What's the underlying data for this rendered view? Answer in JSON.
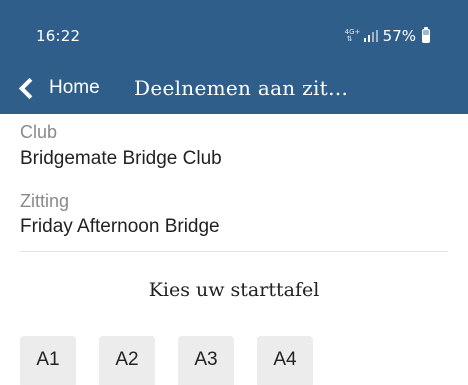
{
  "status_bar": {
    "time": "16:22",
    "network": "4G+",
    "network_icon": "network-4g-plus-icon",
    "signal_icon": "signal-strength-icon",
    "battery_percent": "57%",
    "battery_icon": "battery-icon"
  },
  "app_bar": {
    "back_label": "Home",
    "back_icon": "chevron-left-icon",
    "title": "Deelnemen aan zit…",
    "background_color": "#2f5e8b"
  },
  "club": {
    "label": "Club",
    "value": "Bridgemate Bridge Club"
  },
  "session": {
    "label": "Zitting",
    "value": "Friday Afternoon Bridge"
  },
  "table_prompt": "Kies uw starttafel",
  "tables": [
    {
      "label": "A1"
    },
    {
      "label": "A2"
    },
    {
      "label": "A3"
    },
    {
      "label": "A4"
    }
  ]
}
